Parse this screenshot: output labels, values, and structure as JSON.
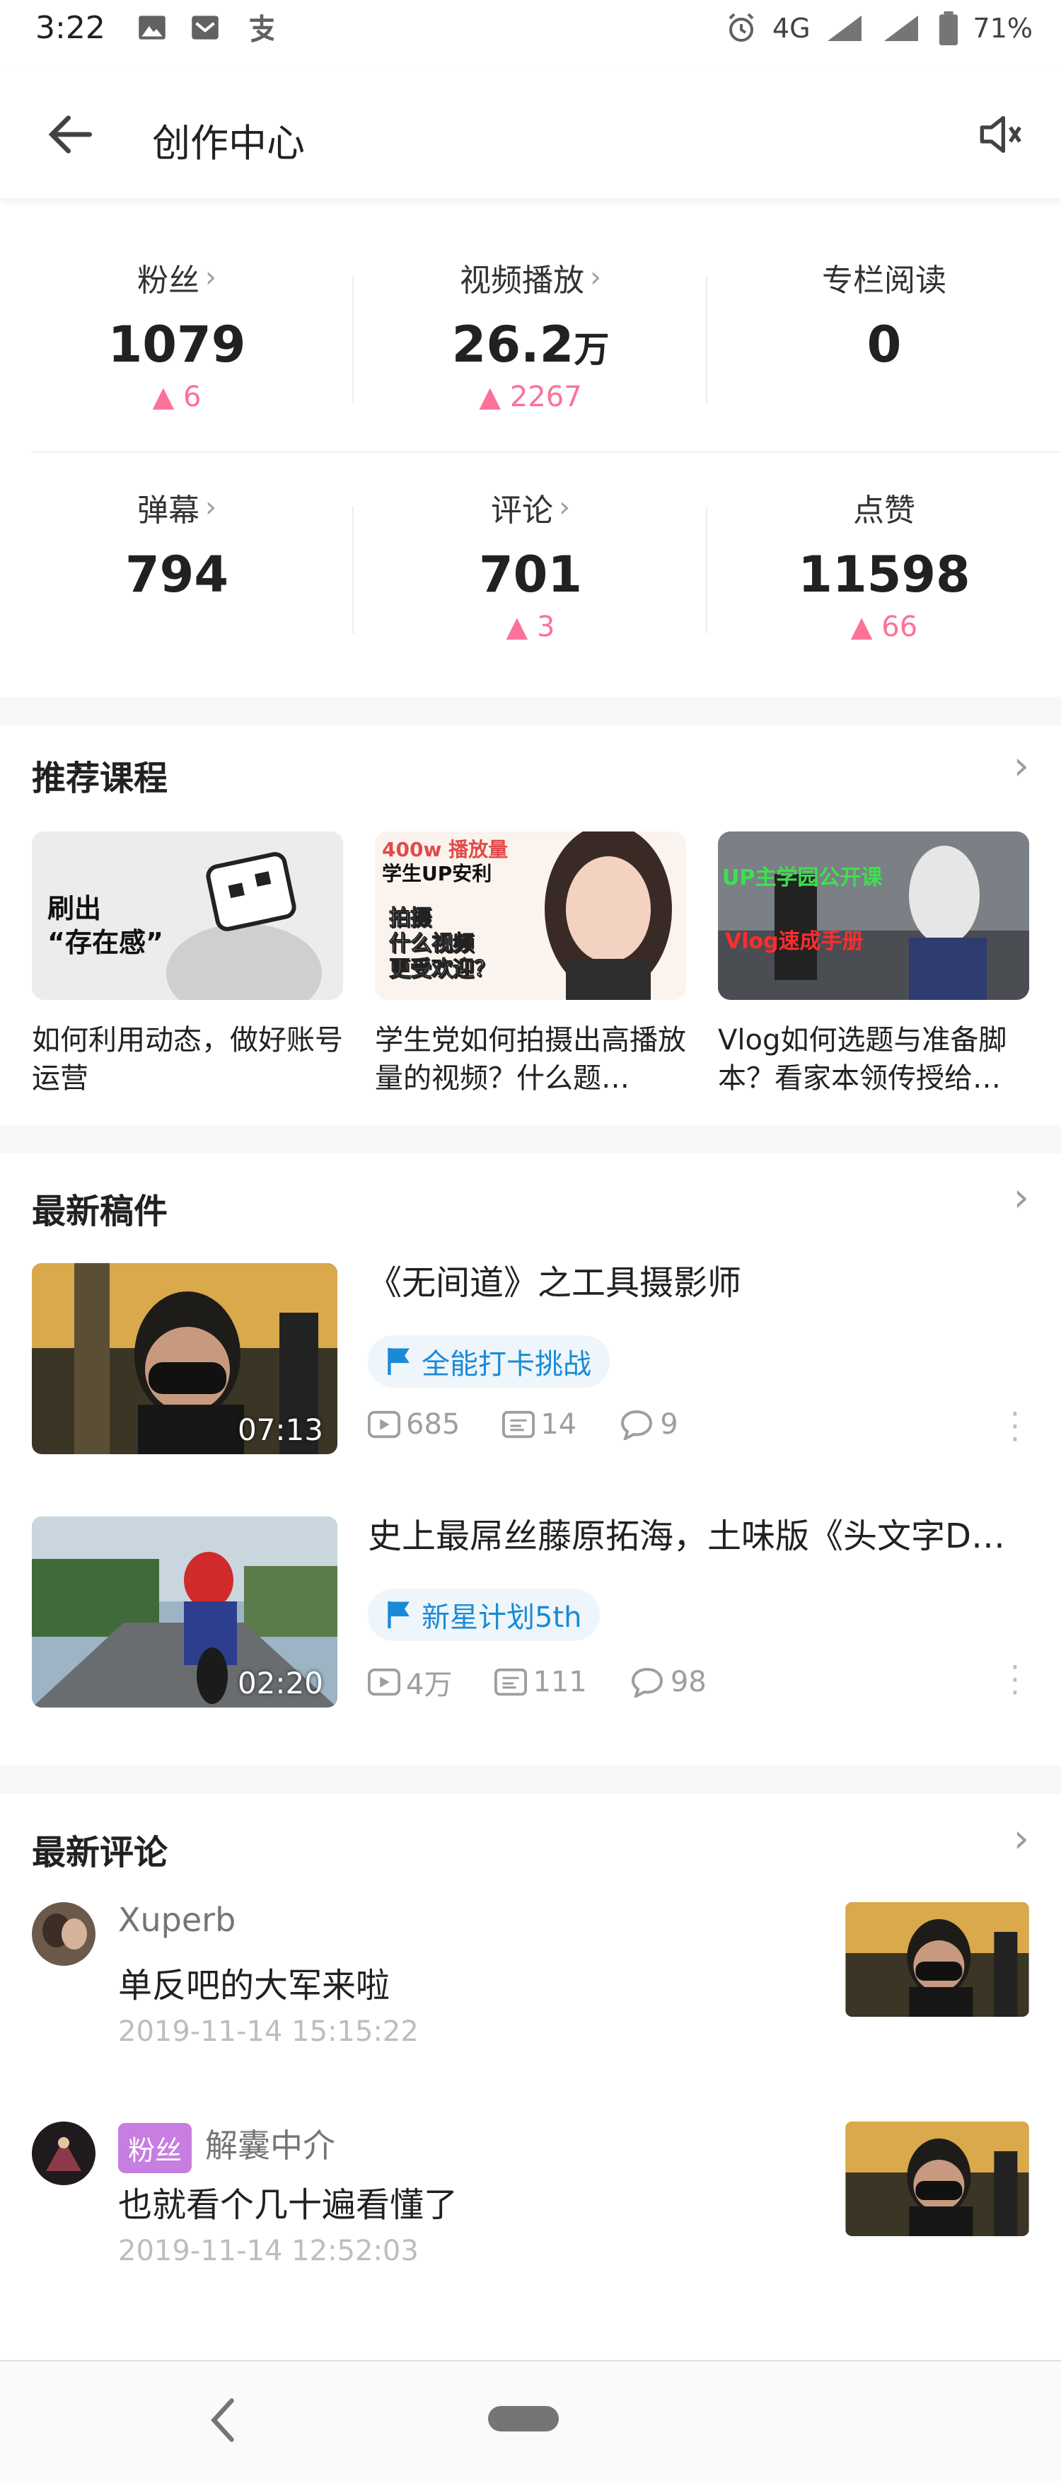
{
  "status_bar": {
    "time": "3:22",
    "network": "4G",
    "battery": "71%"
  },
  "app_bar": {
    "title": "创作中心"
  },
  "stats": [
    {
      "label": "粉丝",
      "value": "1079",
      "unit": "",
      "delta": "6",
      "has_arrow": true
    },
    {
      "label": "视频播放",
      "value": "26.2",
      "unit": "万",
      "delta": "2267",
      "has_arrow": true
    },
    {
      "label": "专栏阅读",
      "value": "0",
      "unit": "",
      "delta": "",
      "has_arrow": false
    },
    {
      "label": "弹幕",
      "value": "794",
      "unit": "",
      "delta": "",
      "has_arrow": true
    },
    {
      "label": "评论",
      "value": "701",
      "unit": "",
      "delta": "3",
      "has_arrow": true
    },
    {
      "label": "点赞",
      "value": "11598",
      "unit": "",
      "delta": "66",
      "has_arrow": false
    }
  ],
  "courses_section": {
    "title": "推荐课程",
    "items": [
      {
        "title": "如何利用动态，做好账号运营",
        "thumb_text": "刷出\n“存在感”"
      },
      {
        "title": "学生党如何拍摄出高播放量的视频？什么题…",
        "thumb_text_1": "400w 播放量",
        "thumb_text_2": "学生UP安利",
        "thumb_text_3": "拍摄\n什么视频\n更受欢迎？"
      },
      {
        "title": "Vlog如何选题与准备脚本？看家本领传授给…",
        "thumb_text_1": "UP主学园公开课",
        "thumb_text_2": "Vlog速成手册"
      }
    ]
  },
  "submissions_section": {
    "title": "最新稿件",
    "items": [
      {
        "title": "《无间道》之工具摄影师",
        "duration": "07:13",
        "tag": "全能打卡挑战",
        "plays": "685",
        "danmaku": "14",
        "comments": "9"
      },
      {
        "title": "史上最屌丝藤原拓海，土味版《头文字D…",
        "duration": "02:20",
        "tag": "新星计划5th",
        "plays": "4万",
        "danmaku": "111",
        "comments": "98"
      }
    ]
  },
  "comments_section": {
    "title": "最新评论",
    "items": [
      {
        "user": "Xuperb",
        "badge": "",
        "text": "单反吧的大军来啦",
        "time": "2019-11-14 15:15:22"
      },
      {
        "user": "解囊中介",
        "badge": "粉丝",
        "text": "也就看个几十遍看懂了",
        "time": "2019-11-14 12:52:03"
      }
    ]
  },
  "colors": {
    "accent_pink": "#fb7299",
    "tag_blue": "#1a8ad6",
    "fan_badge": "#c77ee0"
  }
}
